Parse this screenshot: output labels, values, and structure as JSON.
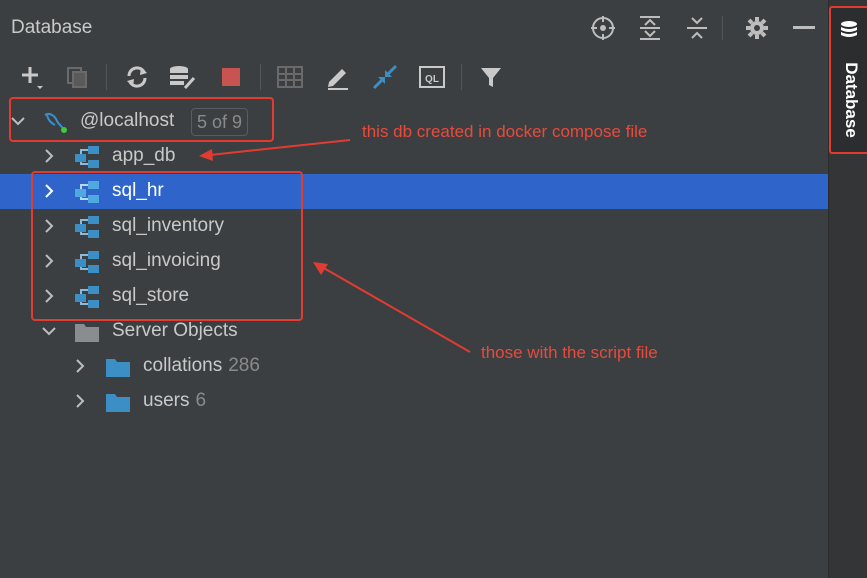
{
  "panel": {
    "title": "Database"
  },
  "header_icons": [
    "locate-icon",
    "expand-all-icon",
    "collapse-all-icon",
    "gear-icon",
    "minimize-icon"
  ],
  "toolbar": {
    "icons": [
      "add-icon",
      "duplicate-icon",
      "refresh-icon",
      "data-source-properties-icon",
      "stop-icon",
      "table-editor-icon",
      "edit-icon",
      "jump-to-console-icon",
      "ql-console-icon",
      "filter-icon"
    ]
  },
  "tree": {
    "root": {
      "label": "@localhost",
      "badge": "5 of 9"
    },
    "databases": [
      {
        "label": "app_db",
        "selected": false
      },
      {
        "label": "sql_hr",
        "selected": true
      },
      {
        "label": "sql_inventory",
        "selected": false
      },
      {
        "label": "sql_invoicing",
        "selected": false
      },
      {
        "label": "sql_store",
        "selected": false
      }
    ],
    "server_objects": {
      "label": "Server Objects",
      "children": [
        {
          "label": "collations",
          "count": "286"
        },
        {
          "label": "users",
          "count": "6"
        }
      ]
    }
  },
  "annotations": {
    "app_db_note": "this db created in docker compose file",
    "script_note": "those with the script file",
    "color": "#e23c32"
  },
  "sidebar": {
    "tab_label": "Database"
  },
  "colors": {
    "background": "#3c3f41",
    "selection": "#2f65ca",
    "schema_icon": "#3b8fc4",
    "stop": "#c75450",
    "jump": "#3b8fc4"
  }
}
